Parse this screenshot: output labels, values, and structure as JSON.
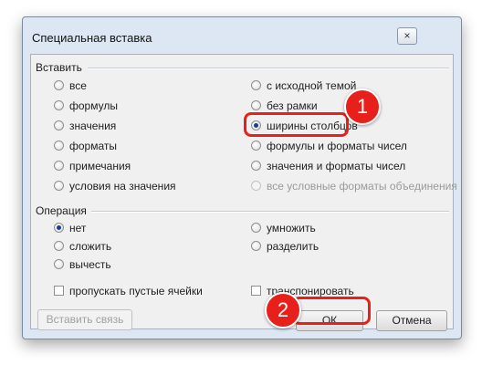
{
  "dialog": {
    "title": "Специальная вставка",
    "close_glyph": "×"
  },
  "paste": {
    "label": "Вставить",
    "left_options": [
      "все",
      "формулы",
      "значения",
      "форматы",
      "примечания",
      "условия на значения"
    ],
    "right_options": [
      "с исходной темой",
      "без рамки",
      "ширины столбцов",
      "формулы и форматы чисел",
      "значения и форматы чисел",
      "все условные форматы объединения"
    ],
    "selected": "ширины столбцов"
  },
  "operation": {
    "label": "Операция",
    "left_options": [
      "нет",
      "сложить",
      "вычесть"
    ],
    "right_options": [
      "умножить",
      "разделить"
    ],
    "selected": "нет"
  },
  "checkboxes": {
    "skip_blanks": "пропускать пустые ячейки",
    "transpose": "транспонировать"
  },
  "buttons": {
    "paste_link": "Вставить связь",
    "ok": "ОК",
    "cancel": "Отмена"
  },
  "annotations": {
    "badge1": "1",
    "badge2": "2",
    "color": "#e8201b"
  }
}
